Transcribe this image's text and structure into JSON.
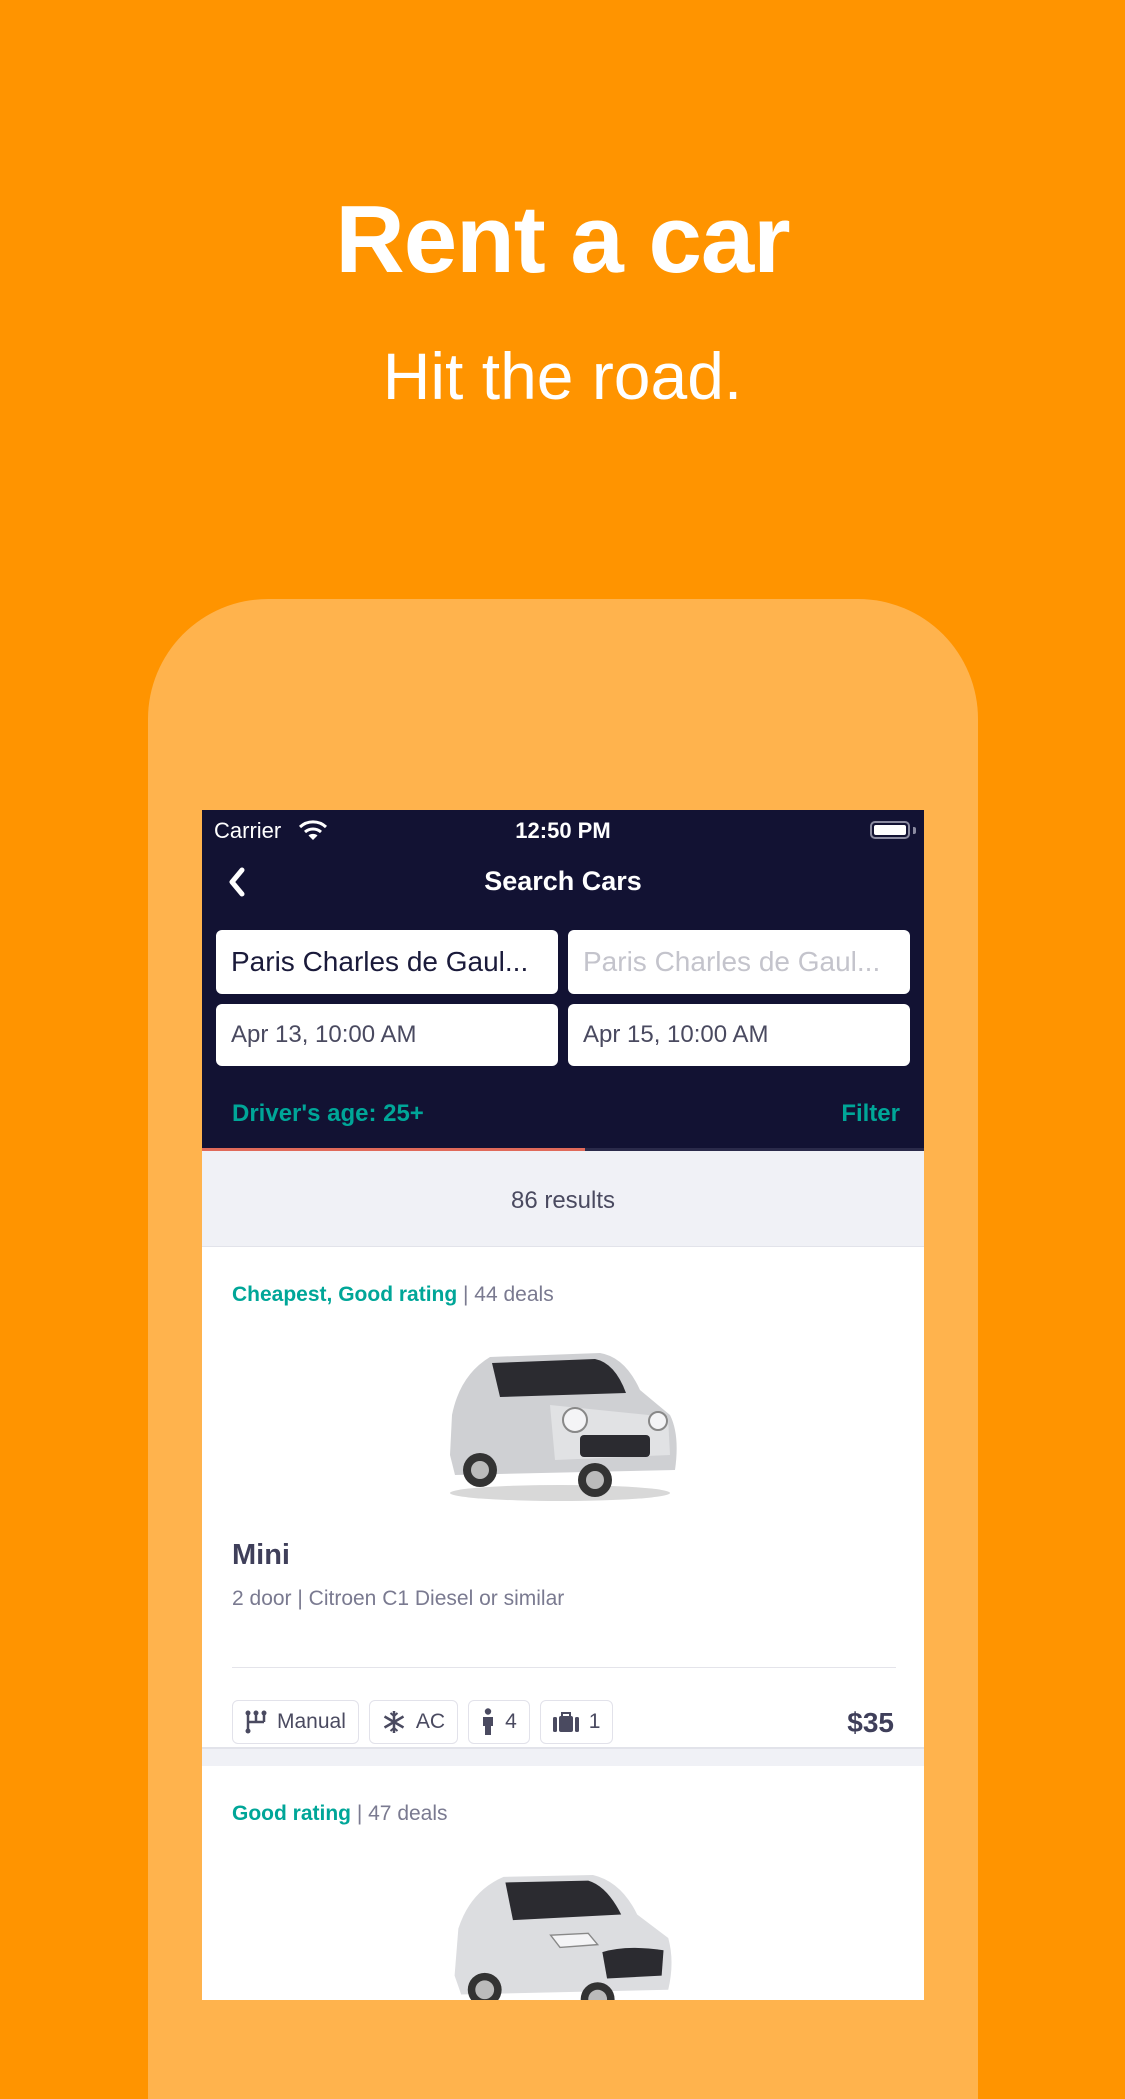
{
  "hero": {
    "title": "Rent a car",
    "subtitle": "Hit the road."
  },
  "status_bar": {
    "carrier": "Carrier",
    "time": "12:50 PM"
  },
  "nav": {
    "title": "Search Cars"
  },
  "search": {
    "pickup_location": "Paris Charles de Gaul...",
    "dropoff_location_placeholder": "Paris Charles de Gaul...",
    "pickup_date": "Apr 13, 10:00 AM",
    "dropoff_date": "Apr 15, 10:00 AM",
    "drivers_age": "Driver's age: 25+",
    "filter_label": "Filter",
    "loading_progress_percent": 53
  },
  "results": {
    "count_label": "86 results"
  },
  "cards": [
    {
      "highlight": "Cheapest, Good rating",
      "deals": " | 44 deals",
      "car_class": "Mini",
      "description": "2 door | Citroen C1 Diesel or similar",
      "transmission": "Manual",
      "ac": "AC",
      "seats": "4",
      "bags": "1",
      "price": "$35"
    },
    {
      "highlight": "Good rating",
      "deals": " | 47 deals"
    }
  ],
  "colors": {
    "background": "#FF9400",
    "phone_frame": "#FFB34D",
    "navbar": "#121233",
    "accent": "#00A698",
    "progress": "#E06A5A"
  }
}
